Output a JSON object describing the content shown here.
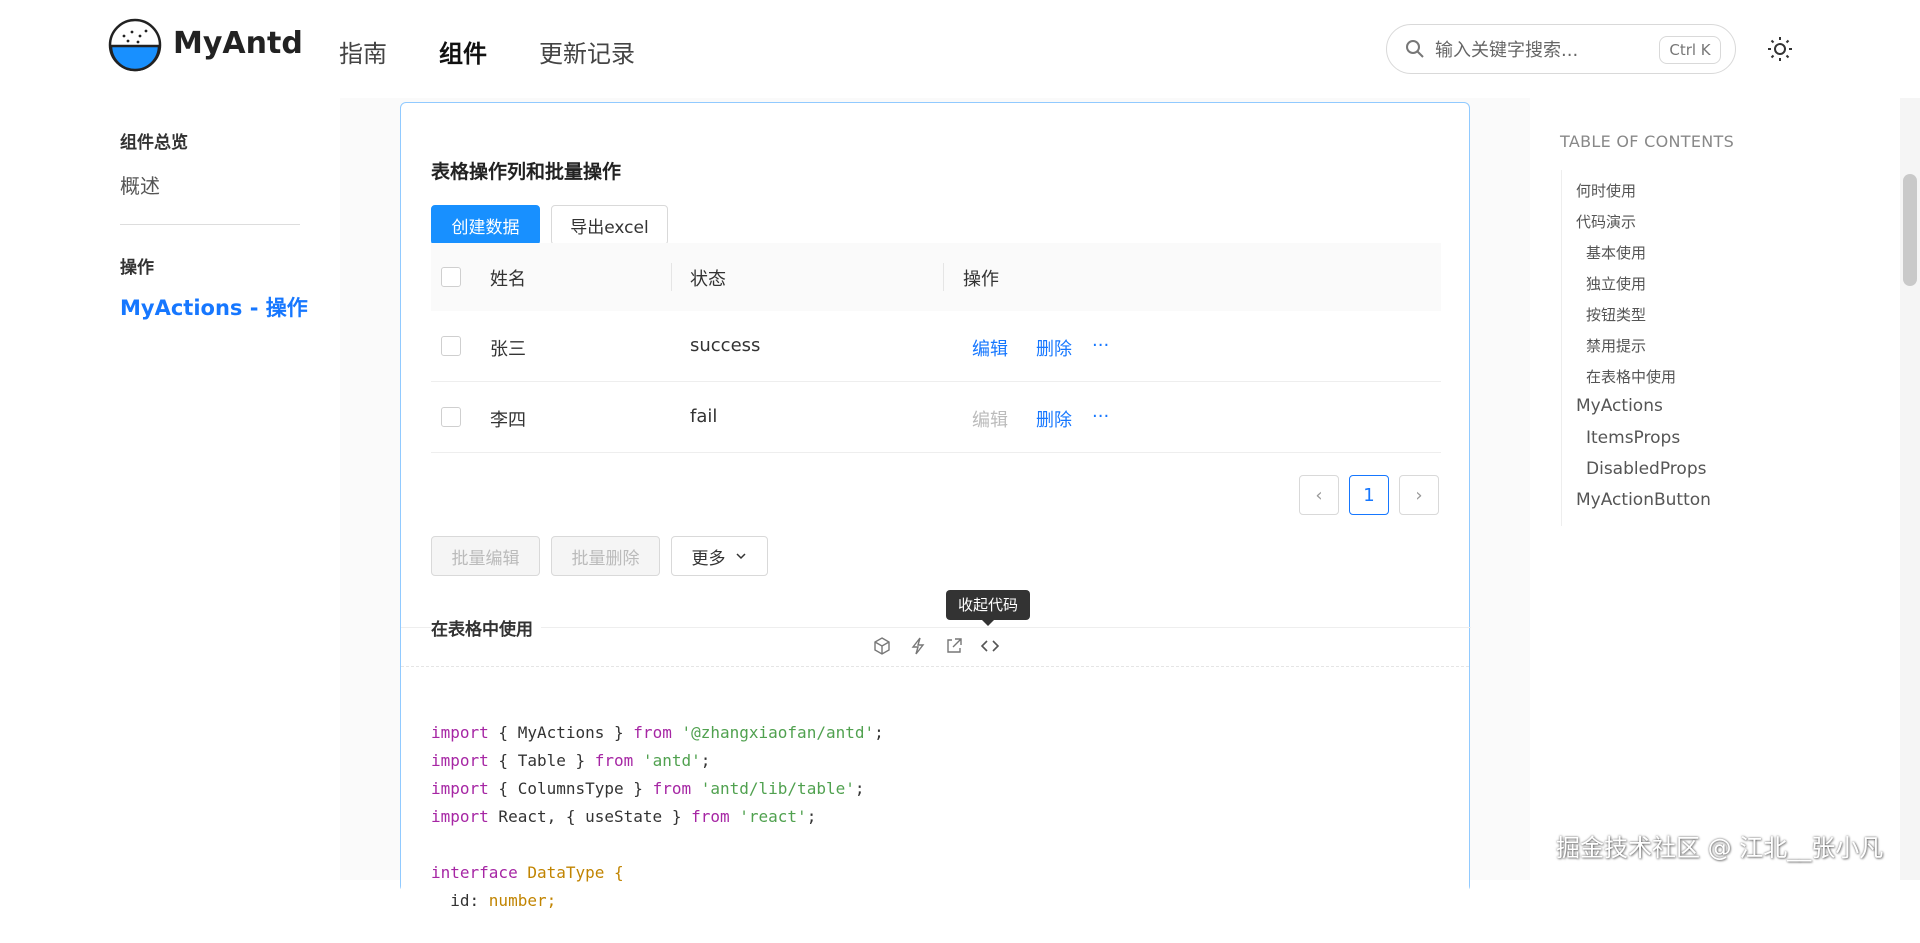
{
  "header": {
    "logo_text": "MyAntd",
    "nav": [
      "指南",
      "组件",
      "更新记录"
    ],
    "search_placeholder": "输入关键字搜索...",
    "shortcut": "Ctrl K"
  },
  "sidebar": {
    "group1": "组件总览",
    "item1": "概述",
    "group2": "操作",
    "item2": "MyActions - 操作"
  },
  "demo": {
    "title": "表格操作列和批量操作",
    "create_button": "创建数据",
    "export_button": "导出excel",
    "columns": [
      "姓名",
      "状态",
      "操作"
    ],
    "rows": [
      {
        "name": "张三",
        "status": "success",
        "edit": "编辑",
        "delete": "删除",
        "more": "···"
      },
      {
        "name": "李四",
        "status": "fail",
        "edit": "编辑",
        "delete": "删除",
        "more": "···"
      }
    ],
    "page": "1",
    "batch_edit": "批量编辑",
    "batch_delete": "批量删除",
    "more": "更多",
    "tooltip": "收起代码",
    "meta_title": "在表格中使用"
  },
  "code": [
    {
      "k1": "import",
      "t1": " { MyActions } ",
      "k2": "from",
      "s": " '@zhangxiaofan/antd'",
      "t2": ";"
    },
    {
      "k1": "import",
      "t1": " { Table } ",
      "k2": "from",
      "s": " 'antd'",
      "t2": ";"
    },
    {
      "k1": "import",
      "t1": " { ColumnsType } ",
      "k2": "from",
      "s": " 'antd/lib/table'",
      "t2": ";"
    },
    {
      "k1": "import",
      "t1": " React, { useState } ",
      "k2": "from",
      "s": " 'react'",
      "t2": ";"
    },
    {
      "k1": "",
      "t1": "",
      "k2": "",
      "s": "",
      "t2": ""
    },
    {
      "k1": "interface",
      "t1": " ",
      "k2": "",
      "s": "",
      "t2": "DataType {"
    },
    {
      "k1": "",
      "t1": "  id: ",
      "k2": "",
      "s": "",
      "t2": "number;"
    }
  ],
  "toc": {
    "title": "TABLE OF CONTENTS",
    "items": [
      "何时使用",
      "代码演示",
      "基本使用",
      "独立使用",
      "按钮类型",
      "禁用提示",
      "在表格中使用",
      "MyActions",
      "ItemsProps",
      "DisabledProps",
      "MyActionButton"
    ]
  },
  "watermark": "掘金技术社区 @ 江北__张小凡"
}
